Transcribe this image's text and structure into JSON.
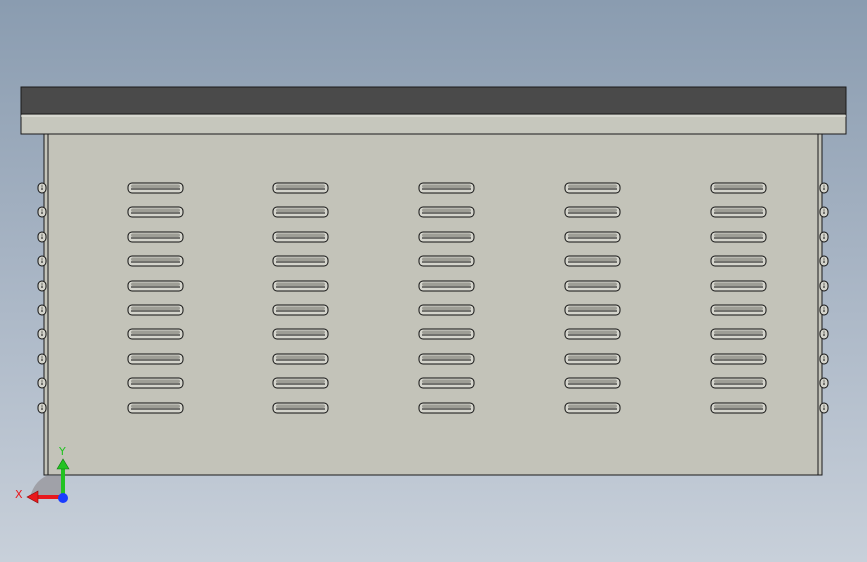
{
  "viewport": {
    "background_top": "#8a9cb0",
    "background_bottom": "#c8d0da"
  },
  "model": {
    "name": "vented-enclosure-front-view",
    "top_cap_color": "#4a4a4a",
    "band_color": "#c6c7bd",
    "panel_color": "#c3c3b9",
    "edge_color": "#1a1a1a",
    "vent_rows": 10,
    "vent_columns": 5
  },
  "triad": {
    "x_label": "X",
    "y_label": "Y",
    "x_color": "#e8181c",
    "y_color": "#22c322",
    "z_color": "#1a3cff"
  }
}
